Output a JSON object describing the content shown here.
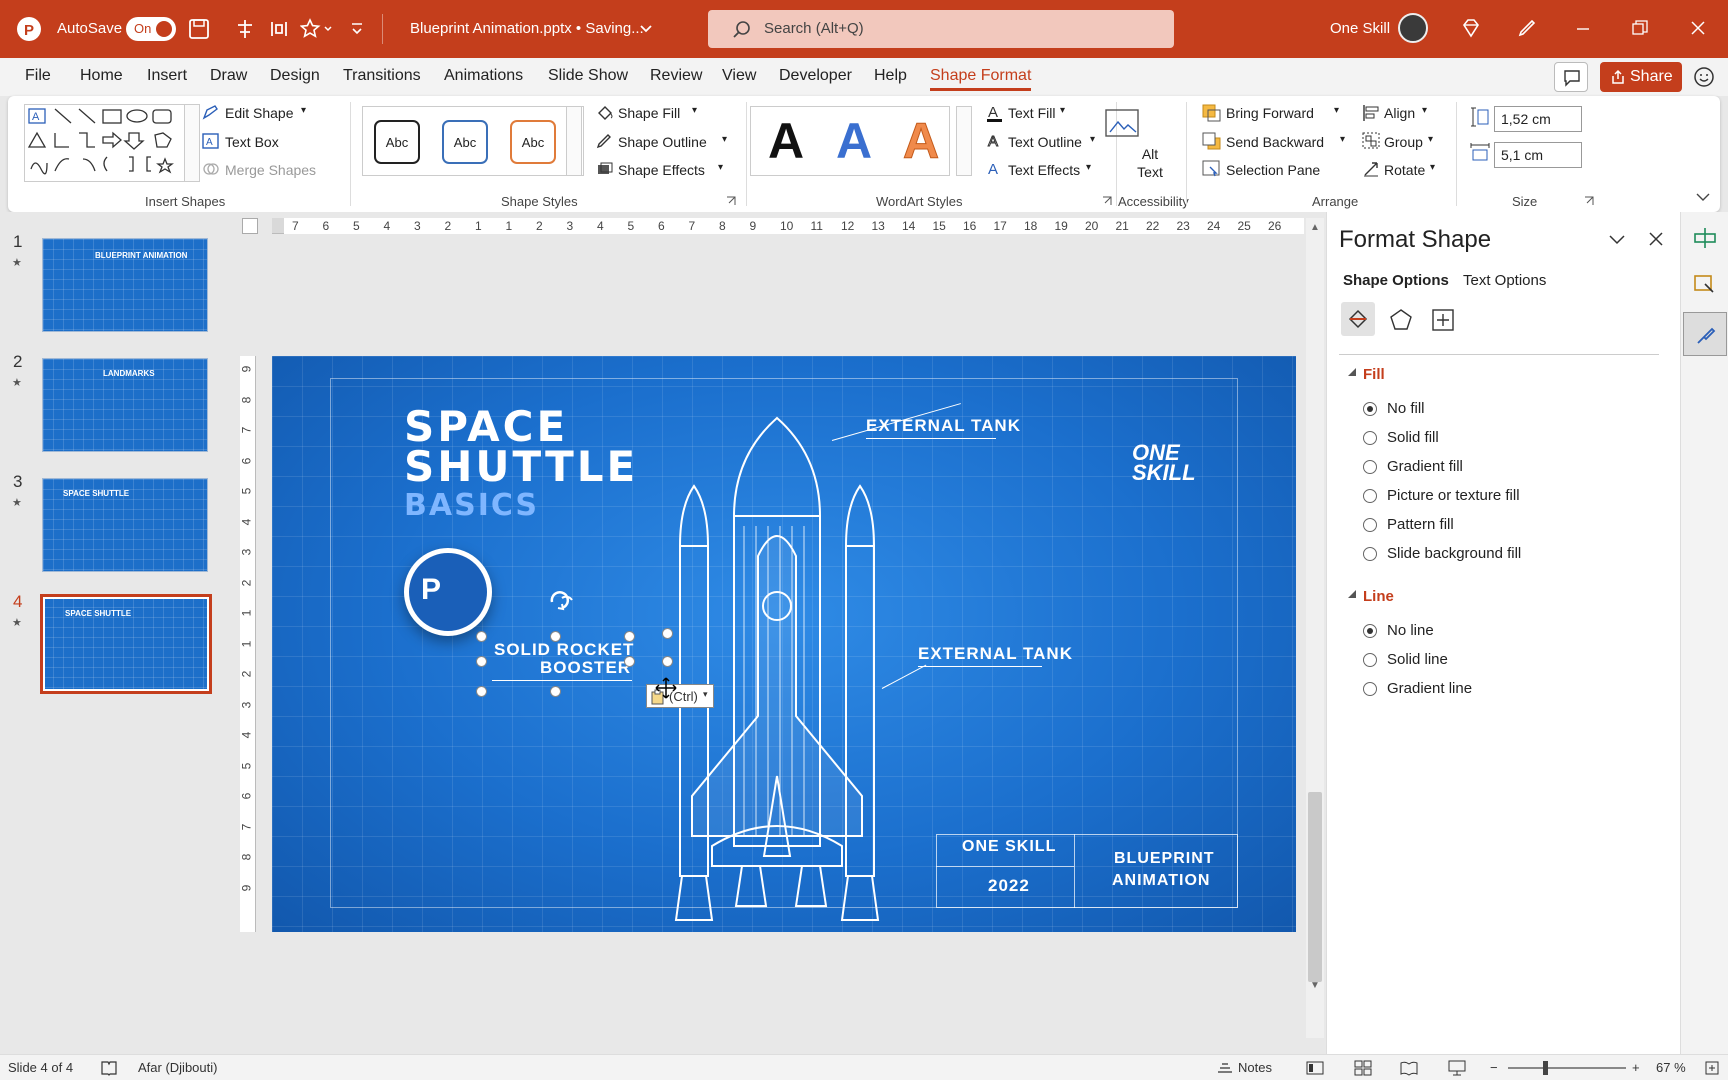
{
  "titlebar": {
    "autosave_label": "AutoSave",
    "autosave_state": "On",
    "filename": "Blueprint Animation.pptx • Saving...",
    "search_placeholder": "Search (Alt+Q)",
    "user_name": "One Skill"
  },
  "tabs": [
    "File",
    "Home",
    "Insert",
    "Draw",
    "Design",
    "Transitions",
    "Animations",
    "Slide Show",
    "Review",
    "View",
    "Developer",
    "Help",
    "Shape Format"
  ],
  "active_tab": "Shape Format",
  "share_label": "Share",
  "ribbon": {
    "insert_shapes": {
      "label": "Insert Shapes",
      "edit_shape": "Edit Shape",
      "text_box": "Text Box",
      "merge_shapes": "Merge Shapes"
    },
    "shape_styles": {
      "label": "Shape Styles",
      "style_sample": "Abc",
      "shape_fill": "Shape Fill",
      "shape_outline": "Shape Outline",
      "shape_effects": "Shape Effects"
    },
    "wordart": {
      "label": "WordArt Styles",
      "sample": "A",
      "text_fill": "Text Fill",
      "text_outline": "Text Outline",
      "text_effects": "Text Effects"
    },
    "accessibility": {
      "label": "Accessibility",
      "alt_text_1": "Alt",
      "alt_text_2": "Text"
    },
    "arrange": {
      "label": "Arrange",
      "bring_forward": "Bring Forward",
      "send_backward": "Send Backward",
      "selection_pane": "Selection Pane",
      "align": "Align",
      "group": "Group",
      "rotate": "Rotate"
    },
    "size": {
      "label": "Size",
      "height": "1,52 cm",
      "width": "5,1 cm"
    }
  },
  "thumbnails": [
    {
      "num": "1",
      "title": "BLUEPRINT ANIMATION"
    },
    {
      "num": "2",
      "title": "LANDMARKS"
    },
    {
      "num": "3",
      "title": "SPACE SHUTTLE"
    },
    {
      "num": "4",
      "title": "SPACE SHUTTLE"
    }
  ],
  "ruler": {
    "h": [
      "7",
      "6",
      "5",
      "4",
      "3",
      "2",
      "1",
      "1",
      "2",
      "3",
      "4",
      "5",
      "6",
      "7",
      "8",
      "9",
      "10",
      "11",
      "12",
      "13",
      "14",
      "15",
      "16",
      "17",
      "18",
      "19",
      "20",
      "21",
      "22",
      "23",
      "24",
      "25",
      "26"
    ],
    "v": [
      "9",
      "8",
      "7",
      "6",
      "5",
      "4",
      "3",
      "2",
      "1",
      "1",
      "2",
      "3",
      "4",
      "5",
      "6",
      "7",
      "8",
      "9"
    ]
  },
  "slide": {
    "title_1": "SPACE",
    "title_2": "SHUTTLE",
    "title_3": "BASICS",
    "logo_letter": "P",
    "label_tank_1": "EXTERNAL TANK",
    "label_tank_2": "EXTERNAL TANK",
    "label_booster_1": "SOLID ROCKET",
    "label_booster_2": "BOOSTER",
    "brand_1": "ONE",
    "brand_2": "SKILL",
    "footer_brand": "ONE SKILL",
    "footer_year": "2022",
    "footer_title_1": "BLUEPRINT",
    "footer_title_2": "ANIMATION",
    "paste_label": "(Ctrl)"
  },
  "pane": {
    "title": "Format Shape",
    "tab_shape": "Shape Options",
    "tab_text": "Text Options",
    "fill_header": "Fill",
    "fill_options": [
      "No fill",
      "Solid fill",
      "Gradient fill",
      "Picture or texture fill",
      "Pattern fill",
      "Slide background fill"
    ],
    "line_header": "Line",
    "line_options": [
      "No line",
      "Solid line",
      "Gradient line"
    ]
  },
  "status": {
    "slide": "Slide 4 of 4",
    "language": "Afar (Djibouti)",
    "notes": "Notes",
    "zoom": "67 %"
  },
  "colors": {
    "accent": "#c43e1c",
    "slide_blue": "#1b6fcd"
  }
}
